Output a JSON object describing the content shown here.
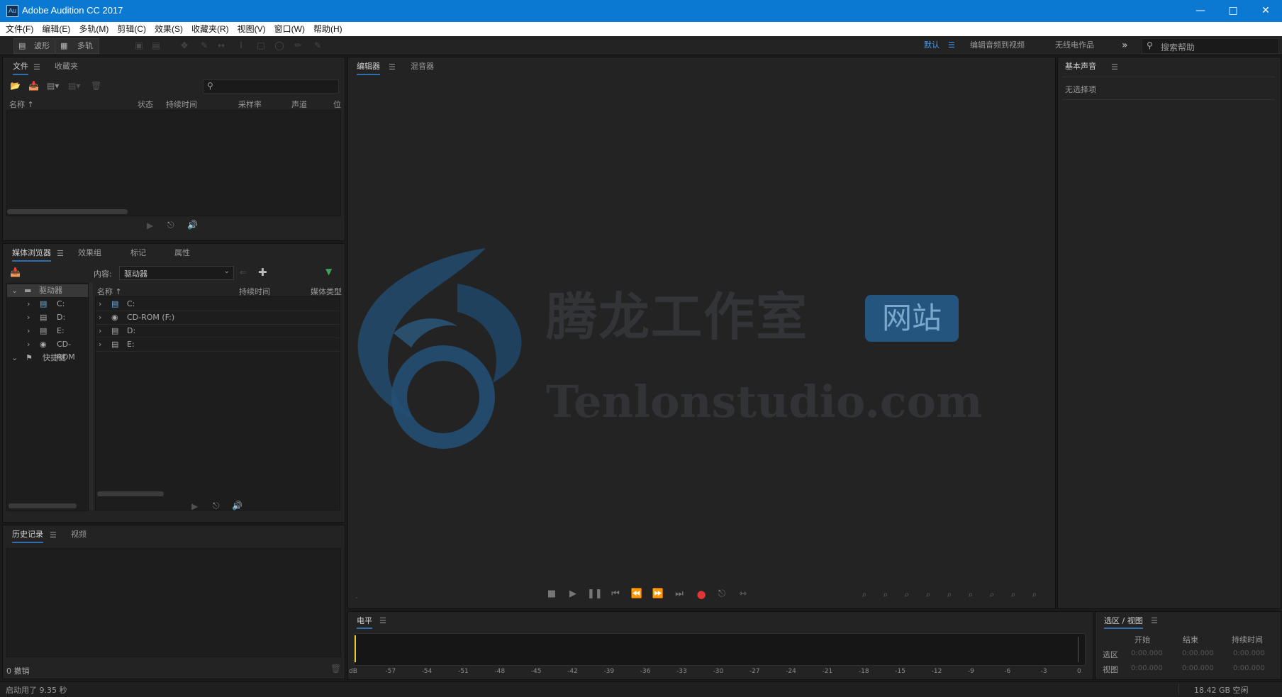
{
  "window": {
    "app_icon_text": "Au",
    "title": "Adobe Audition CC 2017"
  },
  "menu": [
    "文件(F)",
    "编辑(E)",
    "多轨(M)",
    "剪辑(C)",
    "效果(S)",
    "收藏夹(R)",
    "视图(V)",
    "窗口(W)",
    "帮助(H)"
  ],
  "toolbar": {
    "waveform_label": "波形",
    "multitrack_label": "多轨",
    "workspaces": [
      "默认",
      "编辑音频到视频",
      "无线电作品"
    ],
    "active_workspace": "默认",
    "search_placeholder": "搜索帮助"
  },
  "files_panel": {
    "tabs": [
      "文件",
      "收藏夹"
    ],
    "columns": [
      "名称",
      "状态",
      "持续时间",
      "采样率",
      "声道",
      "位"
    ]
  },
  "media_browser": {
    "tabs": [
      "媒体浏览器",
      "效果组",
      "标记",
      "属性"
    ],
    "content_label": "内容:",
    "content_value": "驱动器",
    "tree": {
      "root": "驱动器",
      "drives": [
        "C:",
        "D:",
        "E:",
        "CD-ROM"
      ],
      "shortcuts": "快捷键"
    },
    "columns": [
      "名称",
      "持续时间",
      "媒体类型"
    ],
    "list": [
      "C:",
      "CD-ROM (F:)",
      "D:",
      "E:"
    ]
  },
  "history_panel": {
    "tabs": [
      "历史记录",
      "视频"
    ],
    "undo_count": "0 撤销"
  },
  "editor": {
    "tabs": [
      "编辑器",
      "混音器"
    ],
    "watermark_cn": "腾龙工作室",
    "watermark_badge": "网站",
    "watermark_url": "Tenlonstudio.com",
    "brand_color": "#2a6fa8"
  },
  "essential_sound": {
    "title": "基本声音",
    "status": "无选择项"
  },
  "level_meter": {
    "title": "电平",
    "ticks": [
      "dB",
      "-57",
      "-54",
      "-51",
      "-48",
      "-45",
      "-42",
      "-39",
      "-36",
      "-33",
      "-30",
      "-27",
      "-24",
      "-21",
      "-18",
      "-15",
      "-12",
      "-9",
      "-6",
      "-3",
      "0"
    ]
  },
  "selection_view": {
    "title": "选区 / 视图",
    "columns": [
      "开始",
      "结束",
      "持续时间"
    ],
    "rows": [
      {
        "label": "选区",
        "start": "0:00.000",
        "end": "0:00.000",
        "duration": "0:00.000"
      },
      {
        "label": "视图",
        "start": "0:00.000",
        "end": "0:00.000",
        "duration": "0:00.000"
      }
    ]
  },
  "status_bar": {
    "left": "启动用了 9.35 秒",
    "right": "18.42 GB 空闲"
  },
  "colors": {
    "titlebar": "#0b78d2",
    "record": "#e03535",
    "accent": "#2f6fb0"
  }
}
